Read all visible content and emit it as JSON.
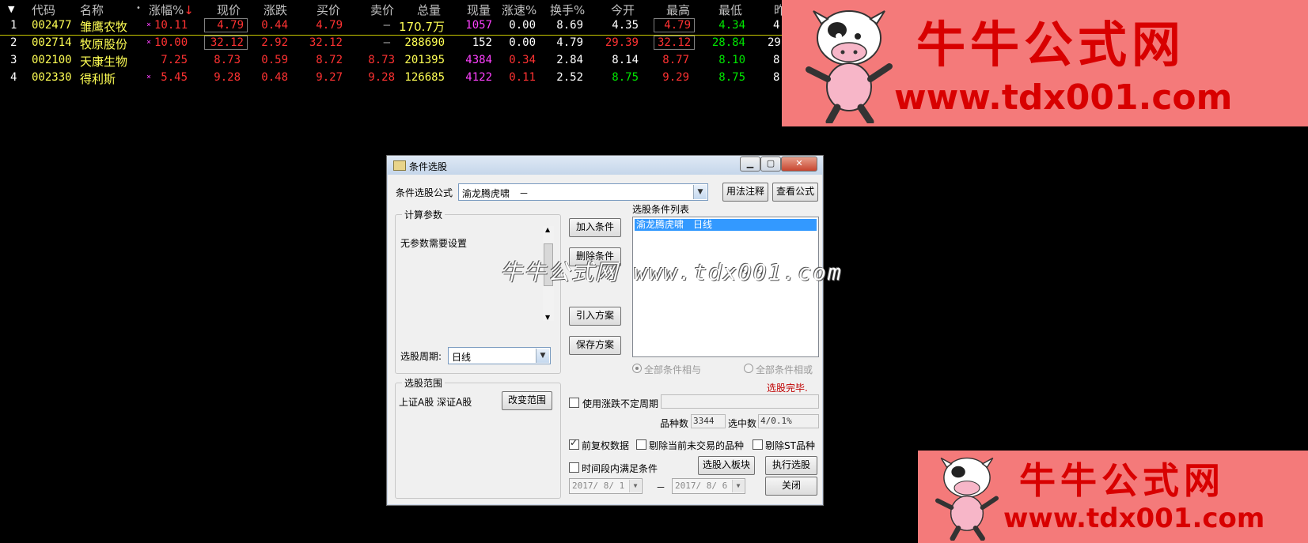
{
  "table": {
    "headers": [
      "代码",
      "名称",
      "涨幅%",
      "现价",
      "涨跌",
      "买价",
      "卖价",
      "总量",
      "现量",
      "涨速%",
      "换手%",
      "今开",
      "最高",
      "最低",
      "昨"
    ],
    "rows": [
      {
        "idx": "1",
        "code": "002477",
        "name": "雏鹰农牧",
        "mark": "×",
        "chg_pct": "10.11",
        "price": "4.79",
        "chg": "0.44",
        "bid": "4.79",
        "ask": "—",
        "vol": "170.7万",
        "cur": "1057",
        "speed": "0.00",
        "turnover": "8.69",
        "open": "4.35",
        "high": "4.79",
        "low": "4.34",
        "prev": "4"
      },
      {
        "idx": "2",
        "code": "002714",
        "name": "牧原股份",
        "mark": "×",
        "chg_pct": "10.00",
        "price": "32.12",
        "chg": "2.92",
        "bid": "32.12",
        "ask": "—",
        "vol": "288690",
        "cur": "152",
        "speed": "0.00",
        "turnover": "4.79",
        "open": "29.39",
        "high": "32.12",
        "low": "28.84",
        "prev": "29"
      },
      {
        "idx": "3",
        "code": "002100",
        "name": "天康生物",
        "mark": "",
        "chg_pct": "7.25",
        "price": "8.73",
        "chg": "0.59",
        "bid": "8.72",
        "ask": "8.73",
        "vol": "201395",
        "cur": "4384",
        "speed": "0.34",
        "turnover": "2.84",
        "open": "8.14",
        "high": "8.77",
        "low": "8.10",
        "prev": "8"
      },
      {
        "idx": "4",
        "code": "002330",
        "name": "得利斯",
        "mark": "×",
        "chg_pct": "5.45",
        "price": "9.28",
        "chg": "0.48",
        "bid": "9.27",
        "ask": "9.28",
        "vol": "126685",
        "cur": "4122",
        "speed": "0.11",
        "turnover": "2.52",
        "open": "8.75",
        "high": "9.29",
        "low": "8.75",
        "prev": "8"
      }
    ]
  },
  "watermark": {
    "brand": "牛牛公式网",
    "url": "www.tdx001.com",
    "overlay": "牛牛公式网 www.tdx001.com"
  },
  "dialog": {
    "title": "条件选股",
    "formula_label": "条件选股公式",
    "formula_value": "渝龙腾虎啸　－",
    "btn_usage": "用法注释",
    "btn_view": "查看公式",
    "params_title": "计算参数",
    "params_text": "无参数需要设置",
    "period_label": "选股周期:",
    "period_value": "日线",
    "btn_add": "加入条件",
    "btn_delete": "删除条件",
    "btn_import": "引入方案",
    "btn_save": "保存方案",
    "cond_list_label": "选股条件列表",
    "cond_item": "渝龙腾虎啸　日线",
    "radio_and": "全部条件相与",
    "radio_or": "全部条件相或",
    "status": "选股完毕.",
    "range_title": "选股范围",
    "range_text": "上证A股 深证A股",
    "btn_change_range": "改变范围",
    "uncertain_period": "使用涨跌不定周期",
    "count_label": "品种数",
    "count_value": "3344",
    "selected_label": "选中数",
    "selected_value": "4/0.1%",
    "chk_prefq": "前复权数据",
    "chk_exclude_notrade": "剔除当前未交易的品种",
    "chk_exclude_st": "剔除ST品种",
    "chk_time_range": "时间段内满足条件",
    "btn_to_block": "选股入板块",
    "btn_execute": "执行选股",
    "date_from": "2017/ 8/ 1",
    "date_sep": "－",
    "date_to": "2017/ 8/ 6",
    "btn_close": "关闭"
  }
}
